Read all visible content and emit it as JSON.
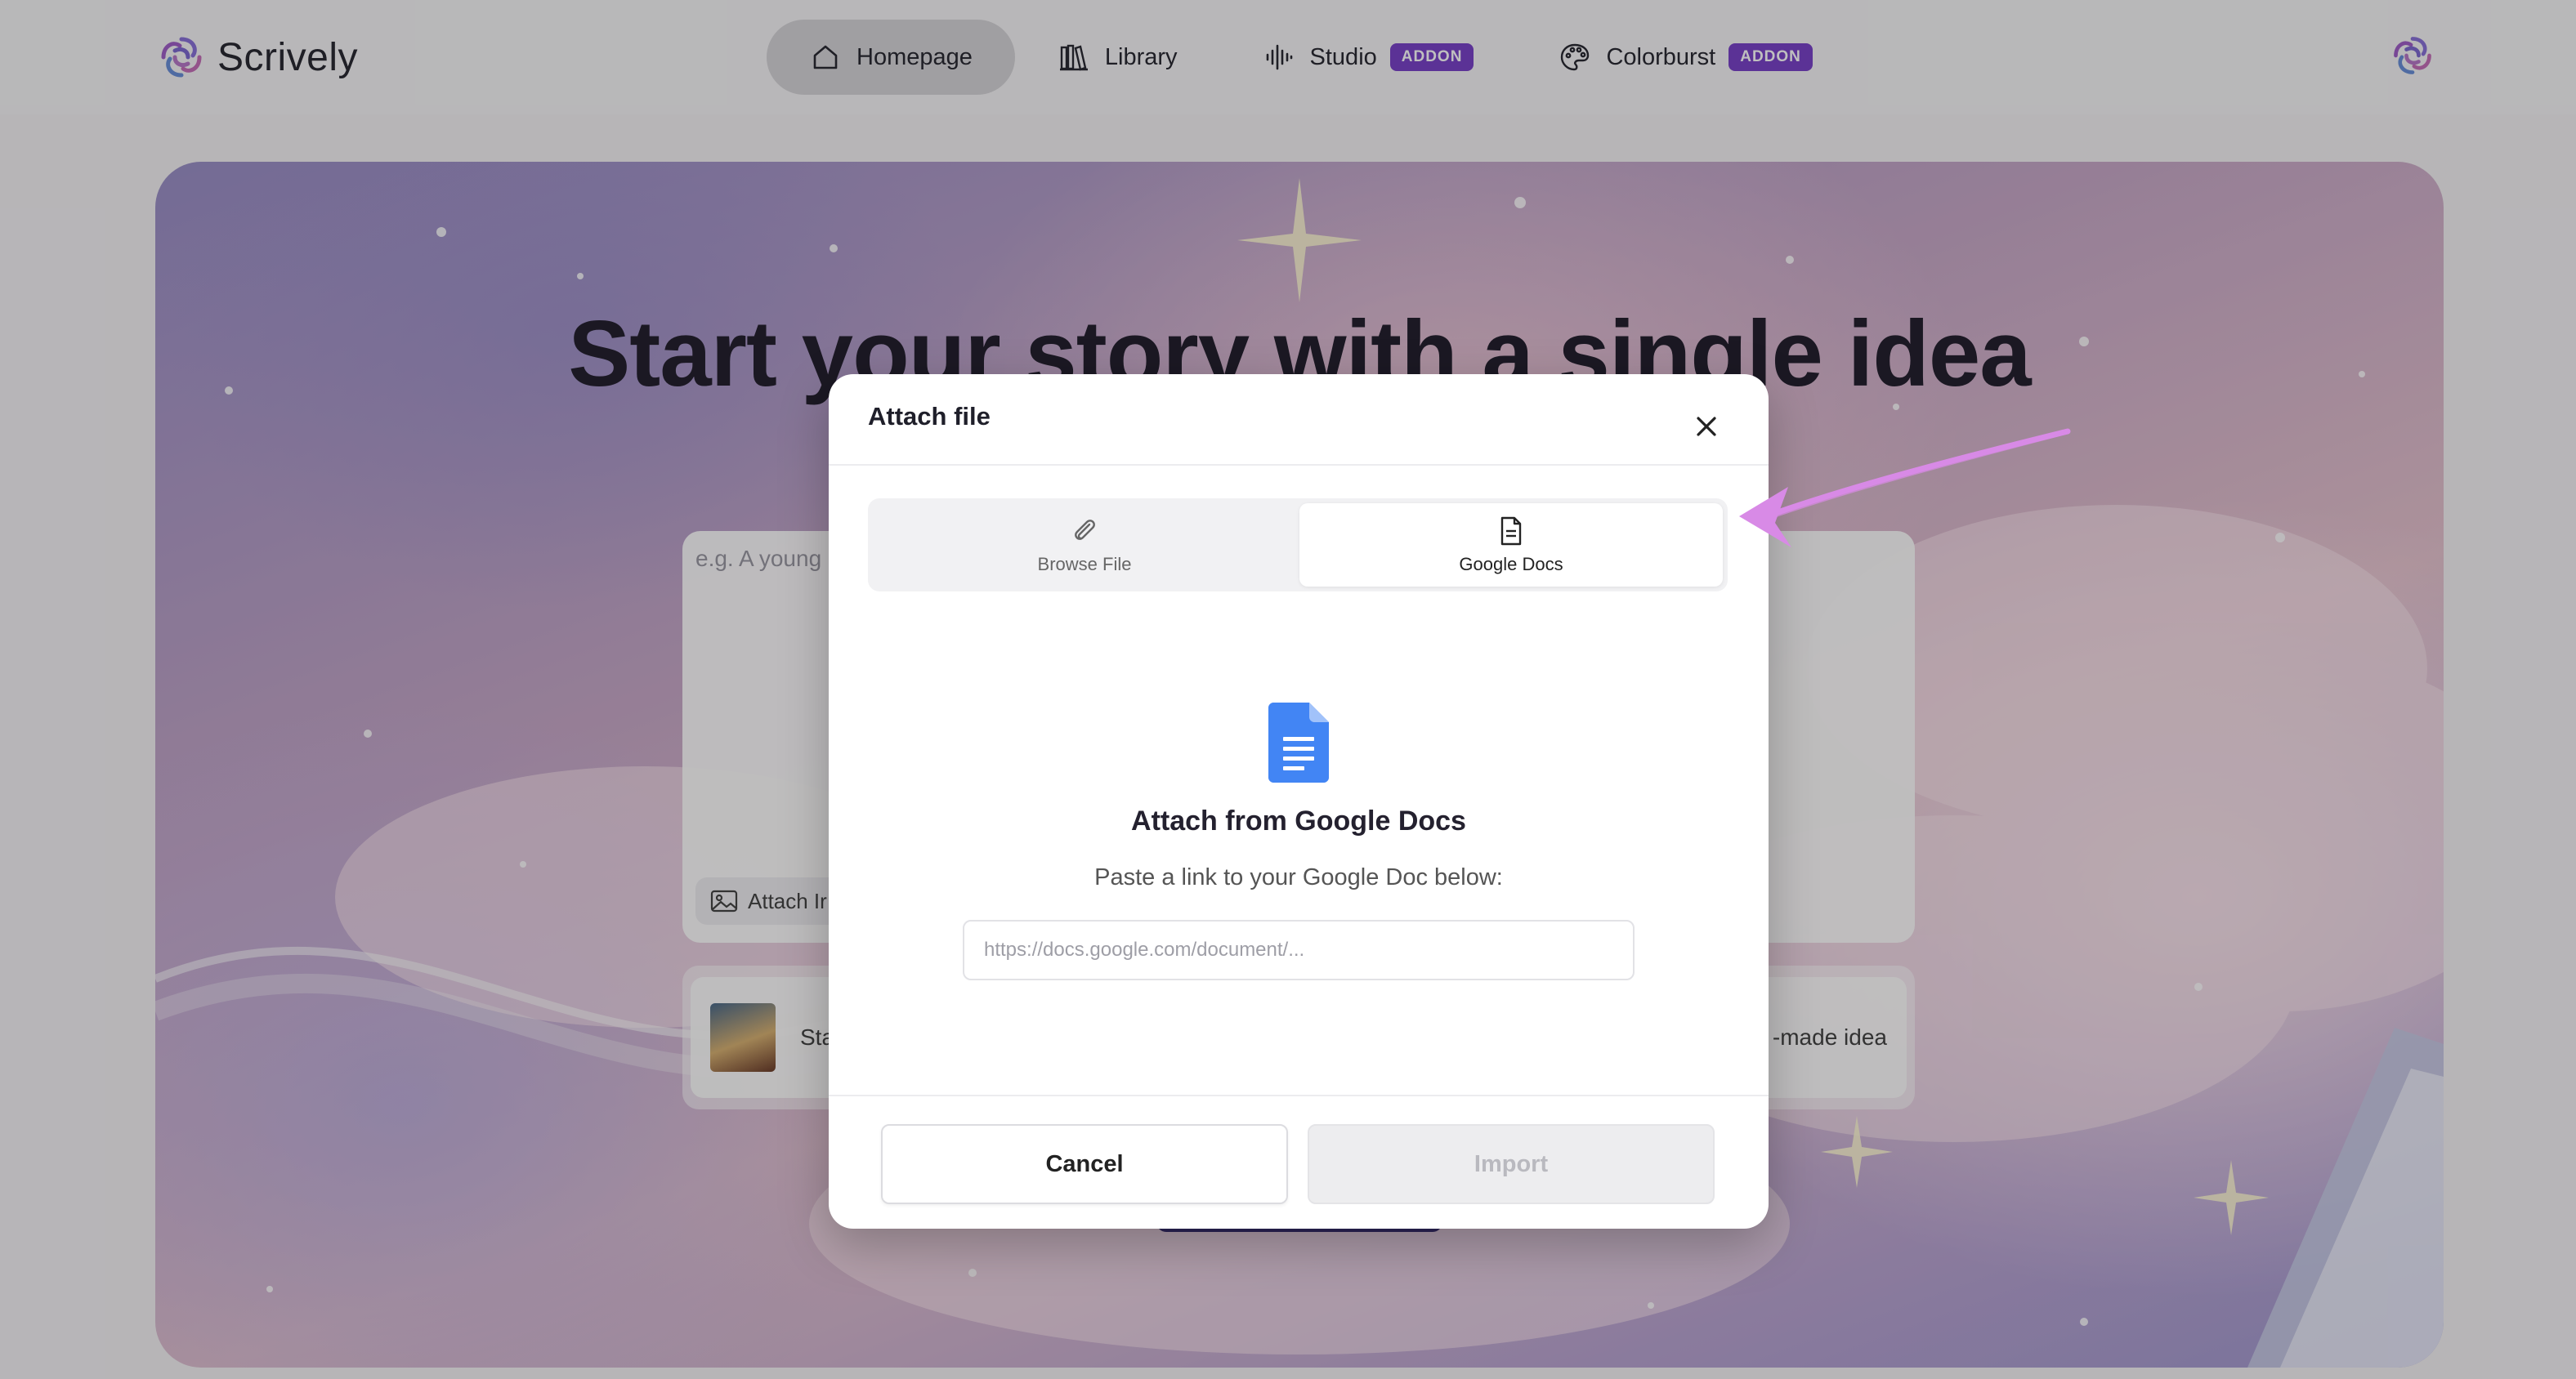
{
  "app": {
    "name": "Scrively"
  },
  "nav": {
    "items": [
      {
        "label": "Homepage",
        "active": true,
        "icon": "home-icon"
      },
      {
        "label": "Library",
        "icon": "books-icon"
      },
      {
        "label": "Studio",
        "icon": "waveform-icon",
        "badge": "ADDON"
      },
      {
        "label": "Colorburst",
        "icon": "palette-icon",
        "badge": "ADDON"
      }
    ]
  },
  "hero": {
    "title": "Start your story with a single idea",
    "prompt_placeholder": "e.g. A young",
    "attach_image_label": "Attach Ir",
    "idea_left_label": "Sta",
    "idea_right_label": "-made idea"
  },
  "modal": {
    "title": "Attach file",
    "tabs": [
      {
        "label": "Browse File",
        "icon": "paperclip-icon"
      },
      {
        "label": "Google Docs",
        "icon": "document-icon",
        "active": true
      }
    ],
    "panel": {
      "icon": "google-docs-icon",
      "title": "Attach from Google Docs",
      "subtitle": "Paste a link to your Google Doc below:",
      "input_placeholder": "https://docs.google.com/document/...",
      "input_value": ""
    },
    "buttons": {
      "cancel": "Cancel",
      "import": "Import"
    }
  },
  "colors": {
    "brand_purple": "#7a43c8",
    "annotation_arrow": "#d88ae6",
    "google_docs_blue": "#4285f4"
  }
}
